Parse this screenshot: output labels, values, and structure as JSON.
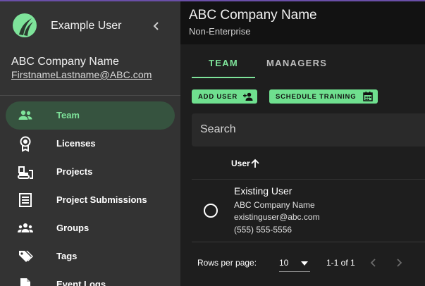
{
  "sidebar": {
    "user_name": "Example User",
    "company": "ABC Company Name",
    "email": "FirstnameLastname@ABC.com",
    "items": [
      {
        "label": "Team",
        "icon": "people-icon",
        "active": true
      },
      {
        "label": "Licenses",
        "icon": "badge-icon"
      },
      {
        "label": "Projects",
        "icon": "bulldozer-icon"
      },
      {
        "label": "Project Submissions",
        "icon": "document-icon"
      },
      {
        "label": "Groups",
        "icon": "groups-icon"
      },
      {
        "label": "Tags",
        "icon": "tags-icon"
      },
      {
        "label": "Event Logs",
        "icon": "file-icon"
      }
    ]
  },
  "header": {
    "company": "ABC Company Name",
    "plan": "Non-Enterprise"
  },
  "tabs": [
    {
      "label": "TEAM",
      "active": true
    },
    {
      "label": "MANAGERS",
      "active": false
    }
  ],
  "actions": {
    "add_user": "ADD USER",
    "schedule_training": "SCHEDULE TRAINING"
  },
  "search": {
    "placeholder": "Search"
  },
  "table": {
    "column_user": "User",
    "rows": [
      {
        "name": "Existing User",
        "company": "ABC Company Name",
        "email": "existinguser@abc.com",
        "phone": "(555) 555-5556"
      }
    ]
  },
  "pagination": {
    "rows_per_page_label": "Rows per page:",
    "rows_per_page": "10",
    "range": "1-1 of 1"
  },
  "colors": {
    "accent": "#7ee39a",
    "sidebar_bg": "#333333",
    "active_bg": "#36533f"
  }
}
